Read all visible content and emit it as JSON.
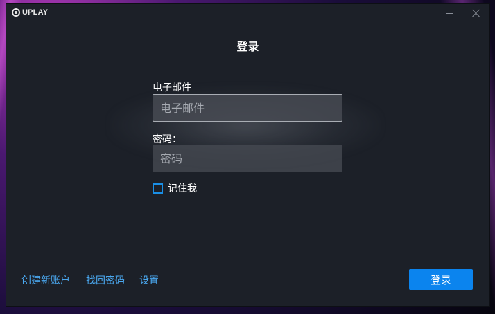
{
  "titlebar": {
    "logo_text": "UPLAY",
    "minimize_icon": "minimize-icon",
    "close_icon": "close-icon"
  },
  "login": {
    "title": "登录",
    "email_label": "电子邮件",
    "email_placeholder": "电子邮件",
    "email_value": "",
    "password_label": "密码：",
    "password_placeholder": "密码",
    "password_value": "",
    "remember_label": "记住我",
    "remember_checked": false
  },
  "footer": {
    "create_account": "创建新账户",
    "recover_password": "找回密码",
    "settings": "设置",
    "login_button": "登录"
  },
  "colors": {
    "window_bg": "#1c2028",
    "accent": "#0b84ee",
    "link": "#4aa8f0"
  }
}
